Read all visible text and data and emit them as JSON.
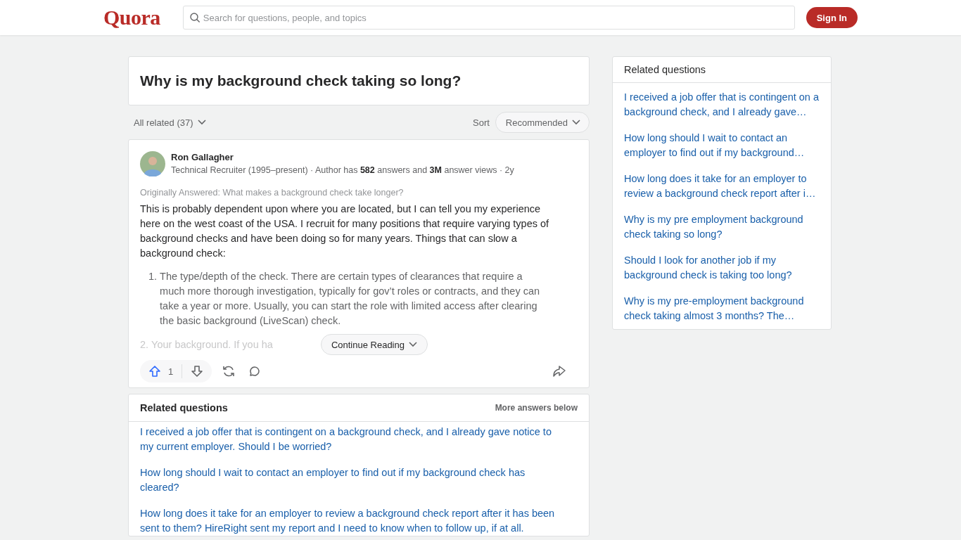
{
  "header": {
    "logo": "Quora",
    "search": {
      "placeholder": "Search for questions, people, and topics"
    },
    "sign_in": "Sign In"
  },
  "question": {
    "title": "Why is my background check taking so long?"
  },
  "filter": {
    "all_related": "All related (37)",
    "sort_label": "Sort",
    "sort_value": "Recommended"
  },
  "answer": {
    "author": "Ron Gallagher",
    "credentials": "Technical Recruiter (1995–present) · Author has **582** answers and **3M** answer views · 2y",
    "originally_answered": "Originally Answered: What makes a background check take longer?",
    "paragraph": "This is probably dependent upon where you are located, but I can tell you my experience here on the west coast of the USA. I recruit for many positions that require varying types of background checks and have been doing so for many years. Things that can slow a background check:",
    "list": [
      {
        "number": "1.",
        "text": "The type/depth of the check. There are certain types of clearances that require a much more thorough investigation, typically for gov’t roles or contracts, and they can take a year or more. Usually, you can start the role with limited access after clearing the basic background (LiveScan) check."
      },
      {
        "number": "2.",
        "text": "Your background. If you ha"
      }
    ],
    "continue_reading": "Continue Reading",
    "upvotes": "1",
    "upvoted": true
  },
  "related_bottom": {
    "title": "Related questions",
    "more": "More answers below",
    "items": [
      "I received a job offer that is contingent on a background check, and I already gave notice to my current employer. Should I be worried?",
      "How long should I wait to contact an employer to find out if my background check has cleared?",
      "How long does it take for an employer to review a background check report after it has been sent to them? HireRight sent my report and I need to know when to follow up, if at all."
    ]
  },
  "related_side": {
    "title": "Related questions",
    "items": [
      "I received a job offer that is contingent on a background check, and I already gave…",
      "How long should I wait to contact an employer to find out if my background…",
      "How long does it take for an employer to review a background check report after i…",
      "Why is my pre employment background check taking so long?",
      "Should I look for another job if my background check is taking too long?",
      "Why is my pre-employment background check taking almost 3 months? The…"
    ]
  }
}
